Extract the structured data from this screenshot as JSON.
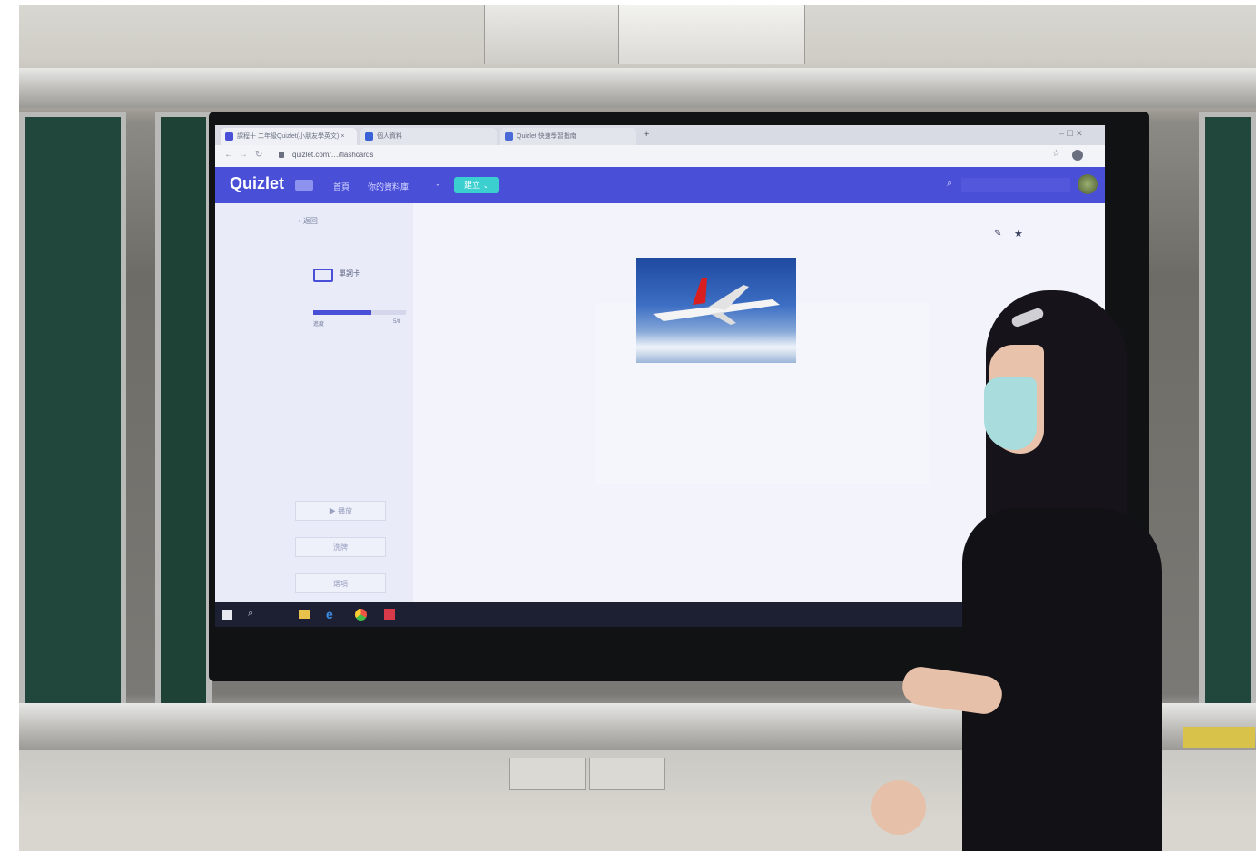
{
  "browser": {
    "tabs": [
      {
        "label": "課程十 二年級Quizlet(小朋友學英文) ×"
      },
      {
        "label": "個人資料"
      },
      {
        "label": "Quizlet 快速學習指南"
      }
    ],
    "url": "quizlet.com/…/flashcards"
  },
  "quizlet": {
    "logo": "Quizlet",
    "nav_home": "首頁",
    "nav_library": "你的資料庫",
    "create_label": "建立",
    "back_label": "返回",
    "mode_label": "單詞卡",
    "progress_label": "進度",
    "progress_count": "5/8",
    "progress_fraction": 0.625,
    "buttons": [
      "▶ 播放",
      "洗牌",
      "選項"
    ]
  },
  "colors": {
    "quizlet_blue": "#4a4fd8",
    "create_button": "#3ccfcf",
    "chalkboard": "#21473d"
  },
  "icons": [
    "pencil-icon",
    "star-icon",
    "search-icon",
    "avatar",
    "windows-start-icon",
    "edge-icon",
    "chrome-icon"
  ]
}
